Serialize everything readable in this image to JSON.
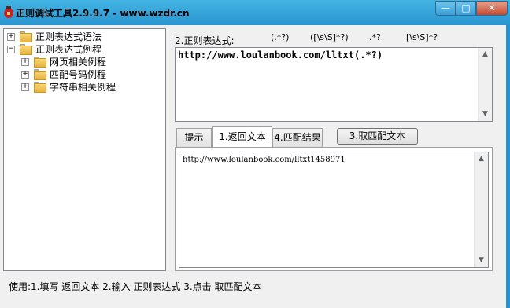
{
  "window": {
    "title": "正则调试工具2.9.9.7 - www.wzdr.cn",
    "controls": {
      "minimize": "—",
      "maximize": "□",
      "close": "✕"
    }
  },
  "tree": {
    "items": [
      {
        "label": "正则表达式语法",
        "expander": "+",
        "level": 0
      },
      {
        "label": "正则表达式例程",
        "expander": "−",
        "level": 0
      },
      {
        "label": "网页相关例程",
        "expander": "+",
        "level": 1
      },
      {
        "label": "匹配号码例程",
        "expander": "+",
        "level": 1
      },
      {
        "label": "字符串相关例程",
        "expander": "+",
        "level": 1
      }
    ]
  },
  "regex": {
    "label": "2.正则表达式:",
    "shortcuts": [
      "(.*?)",
      "([\\s\\S]*?)",
      ".*?",
      "[\\s\\S]*?"
    ],
    "value": "http://www.loulanbook.com/lltxt(.*?)"
  },
  "tabs": [
    {
      "label": "提示",
      "active": false
    },
    {
      "label": "1.返回文本",
      "active": true
    },
    {
      "label": "4.匹配结果",
      "active": false
    }
  ],
  "match_button": "3.取匹配文本",
  "result_text": "http://www.loulanbook.com/lltxt1458971",
  "usage": "使用:1.填写 返回文本 2.输入 正则表达式 3.点击 取匹配文本",
  "colors": {
    "titlebar": "#2a94cf",
    "close": "#c44a2f"
  }
}
